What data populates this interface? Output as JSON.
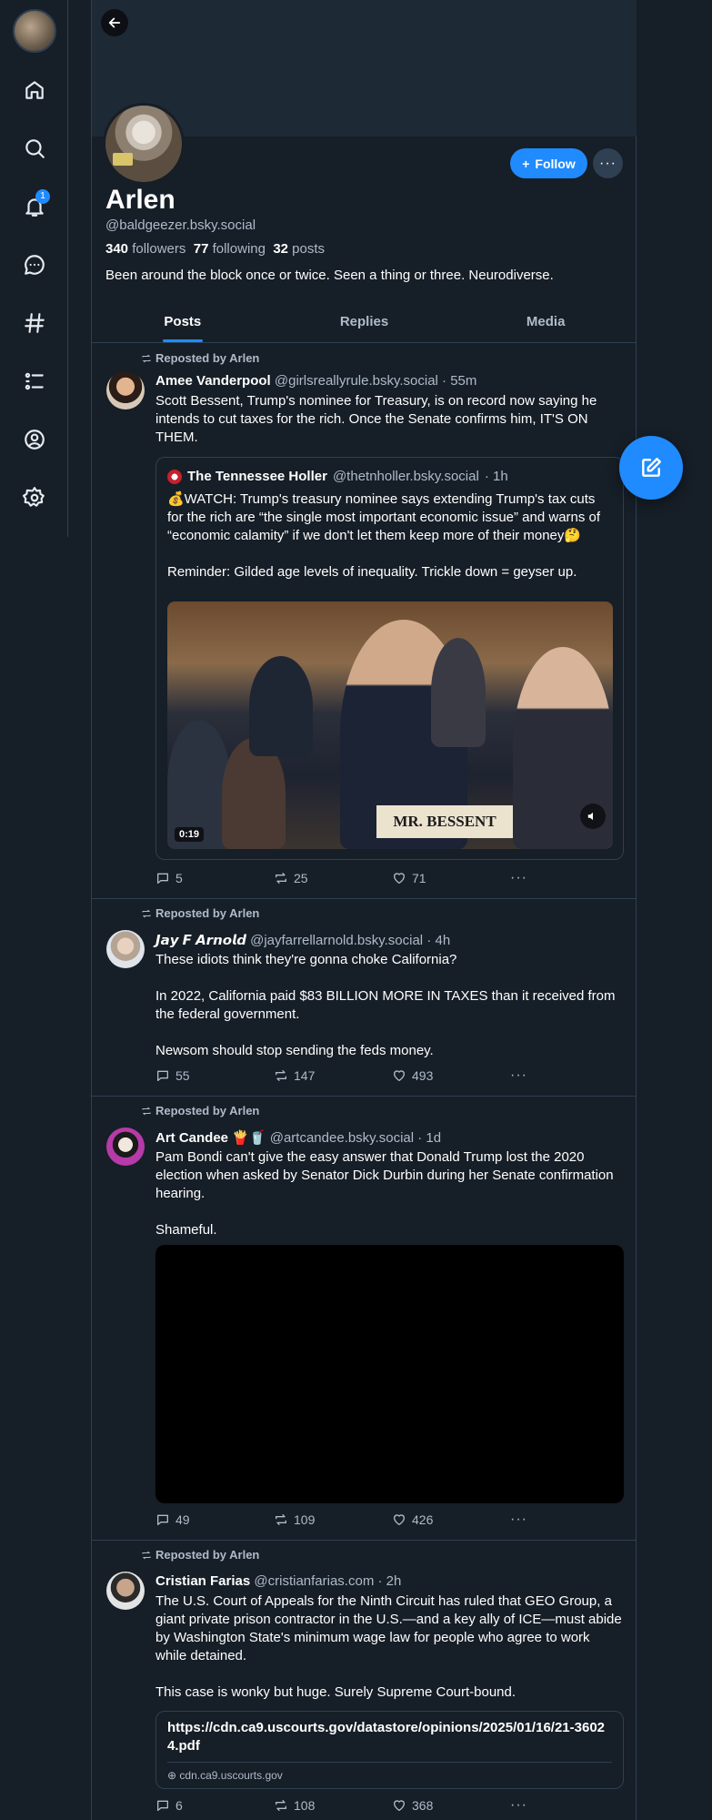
{
  "nav": {
    "notifications_badge": "1",
    "icons": [
      "home-icon",
      "search-icon",
      "bell-icon",
      "chat-icon",
      "hashtag-icon",
      "list-icon",
      "profile-icon",
      "settings-icon"
    ]
  },
  "profile": {
    "display_name": "Arlen",
    "handle": "@baldgeezer.bsky.social",
    "followers_count": "340",
    "followers_label": "followers",
    "following_count": "77",
    "following_label": "following",
    "posts_count": "32",
    "posts_label": "posts",
    "bio": "Been around the block once or twice. Seen a thing or three. Neurodiverse.",
    "follow_label": "Follow",
    "more_label": "···"
  },
  "tabs": [
    {
      "label": "Posts",
      "active": true
    },
    {
      "label": "Replies",
      "active": false
    },
    {
      "label": "Media",
      "active": false
    }
  ],
  "posts": [
    {
      "repost_label": "Reposted by Arlen",
      "author": "Amee Vanderpool",
      "handle": "@girlsreallyrule.bsky.social",
      "time": "· 55m",
      "text": "Scott Bessent, Trump's nominee for Treasury, is on record now saying he intends to cut taxes for the rich. Once the Senate confirms him, IT'S ON THEM.",
      "quote": {
        "author": "The Tennessee Holler",
        "handle": "@thetnholler.bsky.social",
        "time": "· 1h",
        "text": "💰WATCH: Trump's treasury nominee says extending Trump's tax cuts for the rich are “the single most important economic issue” and warns of “economic calamity” if we don't let them keep more of their money🤔\n\nReminder: Gilded age levels of inequality. Trickle down = geyser up.",
        "video_time": "0:19",
        "nameplate": "MR. BESSENT"
      },
      "replies": "5",
      "reposts": "25",
      "likes": "71"
    },
    {
      "repost_label": "Reposted by Arlen",
      "author": "𝙅𝙖𝙮 𝙁 𝘼𝙧𝙣𝙤𝙡𝙙",
      "handle": "@jayfarrellarnold.bsky.social",
      "time": "· 4h",
      "text": "These idiots think they're gonna choke California?\n\nIn 2022, California paid $83 BILLION MORE IN TAXES than it received from the federal government.\n\nNewsom should stop sending the feds money.",
      "replies": "55",
      "reposts": "147",
      "likes": "493"
    },
    {
      "repost_label": "Reposted by Arlen",
      "author": "Art Candee 🍟🥤",
      "handle": "@artcandee.bsky.social",
      "time": "· 1d",
      "text": "Pam Bondi can't give the easy answer that Donald Trump lost the 2020 election when asked by Senator Dick Durbin during her Senate confirmation hearing.\n\nShameful.",
      "replies": "49",
      "reposts": "109",
      "likes": "426"
    },
    {
      "repost_label": "Reposted by Arlen",
      "author": "Cristian Farias",
      "handle": "@cristianfarias.com",
      "time": "· 2h",
      "text": "The U.S. Court of Appeals for the Ninth Circuit has ruled that GEO Group, a giant private prison contractor in the U.S.—and a key ally of ICE—must abide by Washington State's minimum wage law for people who agree to work while detained.\n\nThis case is wonky but huge. Surely Supreme Court-bound.",
      "link": {
        "title": "https://cdn.ca9.uscourts.gov/datastore/opinions/2025/01/16/21-36024.pdf",
        "domain": "cdn.ca9.uscourts.gov"
      },
      "replies": "6",
      "reposts": "108",
      "likes": "368"
    }
  ],
  "dots_label": "···",
  "colors": {
    "accent": "#208bfe",
    "background": "#161e27",
    "border": "#2e4052",
    "muted_text": "#aebbc9"
  }
}
